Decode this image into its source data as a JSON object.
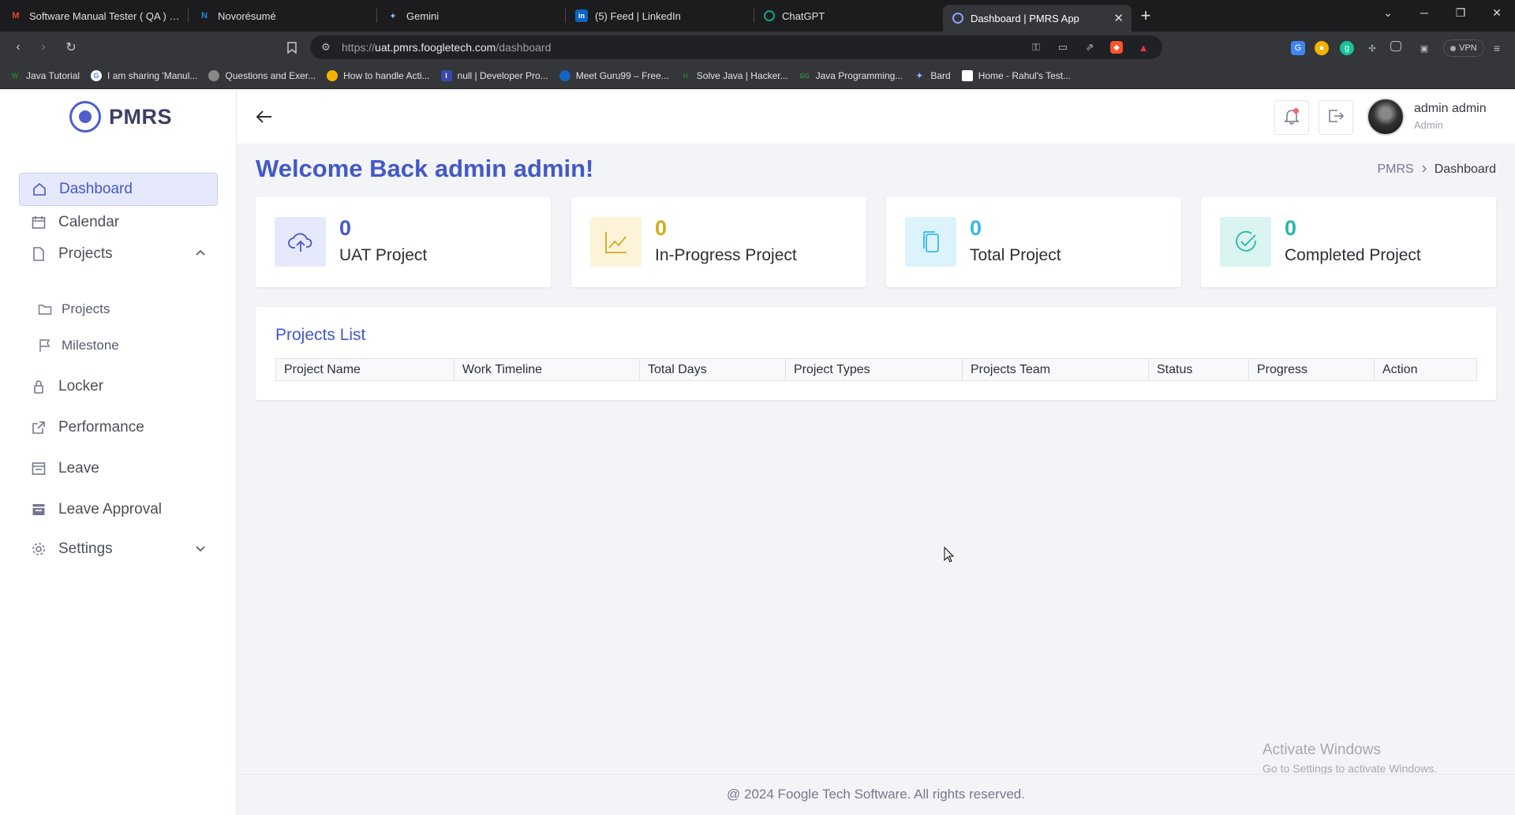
{
  "browser": {
    "tabs": [
      {
        "label": "Software Manual Tester ( QA ) | Umr",
        "icon": "gmail-icon",
        "color": "#ea4335"
      },
      {
        "label": "Novorésumé",
        "icon": "novoresume-icon",
        "color": "#1e88e5"
      },
      {
        "label": "Gemini",
        "icon": "gemini-icon",
        "color": "#8ab4f8"
      },
      {
        "label": "(5) Feed | LinkedIn",
        "icon": "linkedin-icon",
        "color": "#0a66c2"
      },
      {
        "label": "ChatGPT",
        "icon": "chatgpt-icon",
        "color": "#10a37f"
      },
      {
        "label": "Dashboard | PMRS App",
        "icon": "pmrs-icon",
        "color": "#4e5fcb"
      }
    ],
    "url_prefix": "https://",
    "url_host": "uat.pmrs.foogletech.com",
    "url_path": "/dashboard",
    "vpn_label": "VPN",
    "bookmarks": [
      {
        "label": "Java Tutorial",
        "color": "#2e7d32"
      },
      {
        "label": "I am sharing 'Manul...",
        "color": "#4285f4"
      },
      {
        "label": "Questions and Exer...",
        "color": "#777777"
      },
      {
        "label": "How to handle Acti...",
        "color": "#f4b400"
      },
      {
        "label": "null | Developer Pro...",
        "color": "#3949ab"
      },
      {
        "label": "Meet Guru99 – Free...",
        "color": "#1565c0"
      },
      {
        "label": "Solve Java | Hacker...",
        "color": "#2e7d32"
      },
      {
        "label": "Java Programming...",
        "color": "#2f8d46"
      },
      {
        "label": "Bard",
        "color": "#8ab4f8"
      },
      {
        "label": "Home - Rahul's Test...",
        "color": "#ffffff"
      }
    ]
  },
  "app": {
    "brand": "PMRS",
    "sidebar": {
      "items": [
        {
          "label": "Dashboard",
          "icon": "home-icon"
        },
        {
          "label": "Calendar",
          "icon": "calendar-icon"
        },
        {
          "label": "Projects",
          "icon": "file-icon"
        },
        {
          "label": "Projects",
          "icon": "folder-icon"
        },
        {
          "label": "Milestone",
          "icon": "flag-icon"
        },
        {
          "label": "Locker",
          "icon": "lock-icon"
        },
        {
          "label": "Performance",
          "icon": "external-link-icon"
        },
        {
          "label": "Leave",
          "icon": "leave-icon"
        },
        {
          "label": "Leave Approval",
          "icon": "leave-approval-icon"
        },
        {
          "label": "Settings",
          "icon": "gear-icon"
        }
      ]
    },
    "user": {
      "name": "admin admin",
      "role": "Admin"
    },
    "welcome": "Welcome Back admin admin!",
    "breadcrumb": {
      "root": "PMRS",
      "current": "Dashboard"
    },
    "stats": [
      {
        "value": "0",
        "label": "UAT Project",
        "icon": "cloud-upload-icon",
        "color": "#4358c9",
        "bg": "#e5e9fb"
      },
      {
        "value": "0",
        "label": "In-Progress Project",
        "icon": "line-chart-icon",
        "color": "#d4ac1c",
        "bg": "#fcf3d9"
      },
      {
        "value": "0",
        "label": "Total Project",
        "icon": "copy-icon",
        "color": "#3ab8e6",
        "bg": "#dcf3fb"
      },
      {
        "value": "0",
        "label": "Completed Project",
        "icon": "check-circle-icon",
        "color": "#28b7a9",
        "bg": "#d9f4f1"
      }
    ],
    "projects_list": {
      "title": "Projects List",
      "columns": [
        "Project Name",
        "Work Timeline",
        "Total Days",
        "Project Types",
        "Projects Team",
        "Status",
        "Progress",
        "Action"
      ]
    },
    "footer": "@ 2024 Foogle Tech Software. All rights reserved."
  },
  "os_overlay": {
    "line1": "Activate Windows",
    "line2": "Go to Settings to activate Windows."
  }
}
